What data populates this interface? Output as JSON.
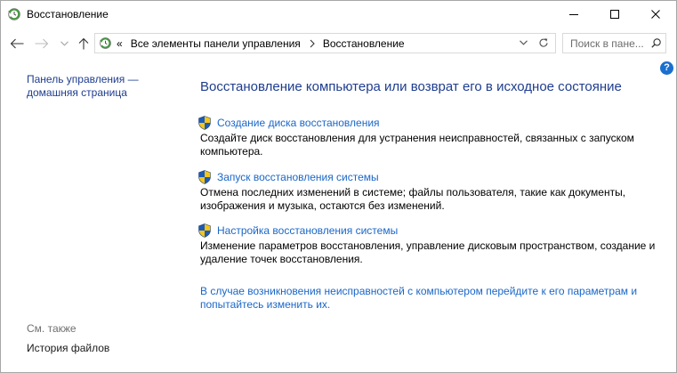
{
  "window": {
    "title": "Восстановление",
    "icon": "recovery-icon",
    "controls": {
      "minimize": "minimize-icon",
      "maximize": "maximize-icon",
      "close": "close-icon"
    }
  },
  "navigation": {
    "back": "back-arrow-icon",
    "forward": "forward-arrow-icon",
    "recent_locations": "chevron-down-icon",
    "up": "up-arrow-icon"
  },
  "address_bar": {
    "icon": "recovery-icon",
    "overflow": "«",
    "crumbs": [
      "Все элементы панели управления",
      "Восстановление"
    ],
    "separator": "chevron-right-icon",
    "dropdown": "chevron-down-icon",
    "refresh": "refresh-icon"
  },
  "search": {
    "placeholder": "Поиск в пане...",
    "icon": "search-icon"
  },
  "help": {
    "label": "?",
    "icon": "help-icon"
  },
  "sidebar": {
    "home_link": [
      "Панель управления —",
      "домашняя страница"
    ],
    "see_also": {
      "heading": "См. также",
      "items": [
        "История файлов"
      ]
    }
  },
  "main": {
    "heading": "Восстановление компьютера или возврат его в исходное состояние",
    "tasks": [
      {
        "icon": "uac-shield-icon",
        "title": "Создание диска восстановления",
        "description": [
          "Создайте диск восстановления для устранения неисправностей, связанных с запуском",
          "компьютера."
        ]
      },
      {
        "icon": "uac-shield-icon",
        "title": "Запуск восстановления системы",
        "description": [
          "Отмена последних изменений в системе; файлы пользователя, такие как документы,",
          "изображения и музыка, остаются без изменений."
        ]
      },
      {
        "icon": "uac-shield-icon",
        "title": "Настройка восстановления системы",
        "description": [
          "Изменение параметров восстановления, управление дисковым пространством, создание и",
          "удаление точек восстановления."
        ]
      }
    ],
    "advanced_link": [
      "В случае возникновения неисправностей с компьютером перейдите к его параметрам и",
      "попытайтесь изменить их."
    ]
  },
  "colors": {
    "heading": "#1e3d8f",
    "nav_link": "#1e3d8f",
    "link": "#1a67c8",
    "secondary_text": "#707070",
    "help_icon": "#1b6fce"
  }
}
